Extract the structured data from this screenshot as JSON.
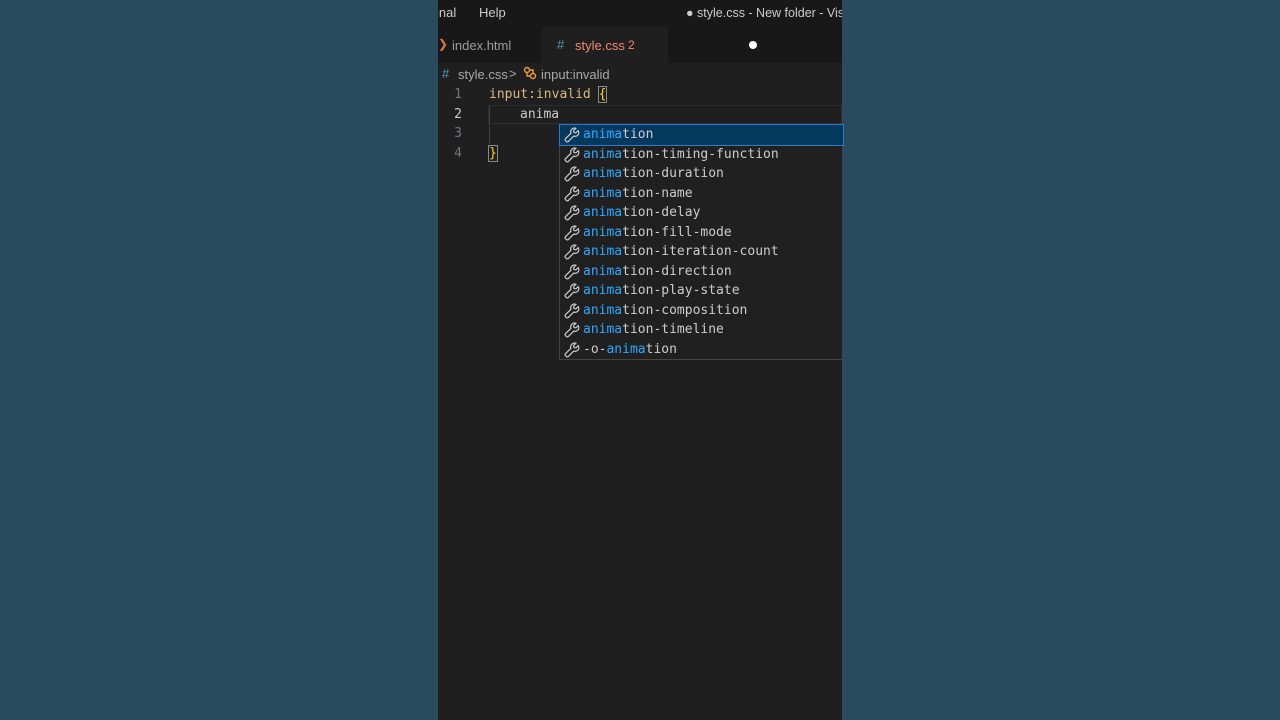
{
  "menu": {
    "terminal": "inal",
    "help": "Help"
  },
  "window_title": "● style.css - New folder - Vis",
  "tabs": [
    {
      "label": "index.html",
      "icon": "html-chevron-icon"
    },
    {
      "label": "style.css",
      "problem_count": "2",
      "modified": true,
      "icon": "css-hash-icon"
    }
  ],
  "breadcrumb": {
    "hash": "#",
    "file": "style.css",
    "separator": ">",
    "symbol": "input:invalid"
  },
  "editor": {
    "line_numbers": [
      "1",
      "2",
      "3",
      "4"
    ],
    "line1_selector": "input:invalid ",
    "line1_brace": "{",
    "line2_text": "anima",
    "line4_brace": "}"
  },
  "suggestions": {
    "match": "anima",
    "items": [
      {
        "prefix": "",
        "match": "anima",
        "rest": "tion"
      },
      {
        "prefix": "",
        "match": "anima",
        "rest": "tion-timing-function"
      },
      {
        "prefix": "",
        "match": "anima",
        "rest": "tion-duration"
      },
      {
        "prefix": "",
        "match": "anima",
        "rest": "tion-name"
      },
      {
        "prefix": "",
        "match": "anima",
        "rest": "tion-delay"
      },
      {
        "prefix": "",
        "match": "anima",
        "rest": "tion-fill-mode"
      },
      {
        "prefix": "",
        "match": "anima",
        "rest": "tion-iteration-count"
      },
      {
        "prefix": "",
        "match": "anima",
        "rest": "tion-direction"
      },
      {
        "prefix": "",
        "match": "anima",
        "rest": "tion-play-state"
      },
      {
        "prefix": "",
        "match": "anima",
        "rest": "tion-composition"
      },
      {
        "prefix": "",
        "match": "anima",
        "rest": "tion-timeline"
      },
      {
        "prefix": "-o-",
        "match": "anima",
        "rest": "tion"
      }
    ],
    "icon": "wrench-icon"
  },
  "colors": {
    "background": "#2b4a5e",
    "editor_bg": "#1f1f1f",
    "selected_suggestion": "#04395e",
    "match_highlight": "#2aaaff",
    "modified_tab_text": "#f48771"
  }
}
